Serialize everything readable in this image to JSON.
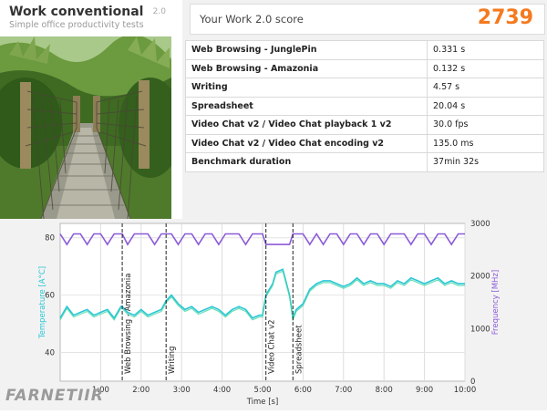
{
  "header": {
    "title": "Work conventional",
    "version": "2.0",
    "subtitle": "Simple office productivity tests"
  },
  "score": {
    "label": "Your Work 2.0 score",
    "value": "2739"
  },
  "results": [
    {
      "name": "Web Browsing - JunglePin",
      "value": "0.331 s"
    },
    {
      "name": "Web Browsing - Amazonia",
      "value": "0.132 s"
    },
    {
      "name": "Writing",
      "value": "4.57 s"
    },
    {
      "name": "Spreadsheet",
      "value": "20.04 s"
    },
    {
      "name": "Video Chat v2 / Video Chat playback 1 v2",
      "value": "30.0 fps"
    },
    {
      "name": "Video Chat v2 / Video Chat encoding v2",
      "value": "135.0 ms"
    },
    {
      "name": "Benchmark duration",
      "value": "37min 32s"
    }
  ],
  "watermark": "FARNETIIR",
  "colors": {
    "score": "#f47a1f",
    "temperature": "#29c6d6",
    "temperature2": "#45d6a8",
    "frequency": "#8c5bd8"
  },
  "chart_data": {
    "type": "line",
    "xlabel": "Time [s]",
    "ylabel_left": "Temperature [A°C]",
    "ylabel_right": "Frequency [MHz]",
    "xlim": [
      0,
      600
    ],
    "ylim_left": [
      30,
      85
    ],
    "ylim_right": [
      0,
      3000
    ],
    "x_ticks": [
      "1:00",
      "2:00",
      "3:00",
      "4:00",
      "5:00",
      "6:00",
      "7:00",
      "8:00",
      "9:00",
      "10:00"
    ],
    "y_ticks_left": [
      "40",
      "60",
      "80"
    ],
    "y_ticks_right": [
      "0",
      "1000",
      "2000",
      "3000"
    ],
    "grid": true,
    "markers": [
      {
        "label": "Web Browsing - Amazonia",
        "x": 92
      },
      {
        "label": "Writing",
        "x": 157
      },
      {
        "label": "Video Chat v2",
        "x": 305
      },
      {
        "label": "Spreadsheet",
        "x": 345
      }
    ],
    "series": [
      {
        "axis": "left",
        "x": [
          0,
          10,
          20,
          30,
          40,
          50,
          60,
          70,
          80,
          90,
          92,
          100,
          110,
          120,
          130,
          140,
          150,
          157,
          165,
          175,
          185,
          195,
          205,
          215,
          225,
          235,
          245,
          255,
          265,
          275,
          285,
          295,
          300,
          305,
          310,
          315,
          320,
          330,
          340,
          345,
          350,
          360,
          370,
          380,
          390,
          400,
          410,
          420,
          430,
          440,
          450,
          460,
          470,
          480,
          490,
          500,
          510,
          520,
          530,
          540,
          550,
          560,
          570,
          580,
          590,
          600
        ],
        "values": [
          52,
          56,
          53,
          54,
          55,
          53,
          54,
          55,
          52,
          56,
          56,
          54,
          53,
          55,
          53,
          54,
          55,
          58,
          60,
          57,
          55,
          56,
          54,
          55,
          56,
          55,
          53,
          55,
          56,
          55,
          52,
          53,
          53,
          60,
          62,
          64,
          68,
          69,
          60,
          52,
          55,
          57,
          62,
          64,
          65,
          65,
          64,
          63,
          64,
          66,
          64,
          65,
          64,
          64,
          63,
          65,
          64,
          66,
          65,
          64,
          65,
          66,
          64,
          65,
          64,
          64
        ]
      },
      {
        "axis": "right",
        "x": [
          0,
          10,
          20,
          30,
          40,
          50,
          60,
          70,
          80,
          90,
          92,
          100,
          110,
          120,
          130,
          140,
          150,
          157,
          165,
          175,
          185,
          195,
          205,
          215,
          225,
          235,
          245,
          255,
          265,
          275,
          285,
          295,
          300,
          305,
          310,
          315,
          320,
          330,
          340,
          345,
          350,
          360,
          370,
          380,
          390,
          400,
          410,
          420,
          430,
          440,
          450,
          460,
          470,
          480,
          490,
          500,
          510,
          520,
          530,
          540,
          550,
          560,
          570,
          580,
          590,
          600
        ],
        "values": [
          2800,
          2600,
          2800,
          2800,
          2600,
          2800,
          2800,
          2600,
          2800,
          2800,
          2800,
          2600,
          2800,
          2800,
          2800,
          2600,
          2800,
          2800,
          2800,
          2600,
          2800,
          2800,
          2600,
          2800,
          2800,
          2600,
          2800,
          2800,
          2800,
          2600,
          2800,
          2800,
          2800,
          2600,
          2600,
          2600,
          2600,
          2600,
          2600,
          2800,
          2800,
          2800,
          2600,
          2800,
          2600,
          2800,
          2800,
          2600,
          2800,
          2800,
          2600,
          2800,
          2800,
          2600,
          2800,
          2800,
          2800,
          2600,
          2800,
          2800,
          2600,
          2800,
          2800,
          2600,
          2800,
          2800
        ]
      }
    ]
  }
}
